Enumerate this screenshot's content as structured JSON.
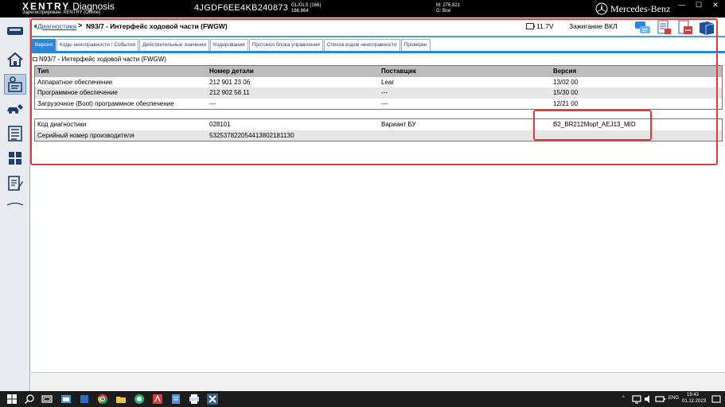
{
  "app": {
    "brand_name": "XENTRY",
    "brand_suffix": "Diagnosis",
    "registration": "Зарегистрирован: XENTRY (Offline)",
    "vin": "4JGDF6EE4KB240873",
    "gl_line1": "GL/GLS (166)",
    "gl_line2": "166.864",
    "stat_m": "M: 276.821",
    "stat_g": "G: Все",
    "maker": "Mercedes-Benz",
    "win_minimize": "—",
    "win_maximize": "☐",
    "win_close": "✕"
  },
  "header": {
    "breadcrumb_link": "Диагностика",
    "breadcrumb_sep": ">",
    "title": "N93/7 - Интерфейс ходовой части (FWGW)",
    "voltage": "11.7V",
    "ignition": "Зажигание ВКЛ"
  },
  "tabs": [
    {
      "label": "Версия"
    },
    {
      "label": "Коды неисправности / События"
    },
    {
      "label": "Действительные значения"
    },
    {
      "label": "Кодирования"
    },
    {
      "label": "Протокол блока управления"
    },
    {
      "label": "Список кодов неисправности"
    },
    {
      "label": "Проверки"
    }
  ],
  "main": {
    "section_title": "N93/7 - Интерфейс ходовой части (FWGW)",
    "columns": [
      "Тип",
      "Номер детали",
      "Поставщик",
      "Версия"
    ],
    "rows": [
      [
        "Аппаратное обеспечение",
        "212 901 23 06",
        "Lear",
        "13/02 00"
      ],
      [
        "Программное обеспечение",
        "212 902 58 11",
        "---",
        "15/30 00"
      ],
      [
        "Загрузочное (Boot) программное обеспечение",
        "---",
        "---",
        "12/21 00"
      ]
    ],
    "info_rows": [
      [
        "Код диагностики",
        "028101",
        "Вариант БУ",
        "B2_BR212Mopf_AEJ13_MID"
      ],
      [
        "Серийный номер производителя",
        "5325378220544138021811З0",
        "",
        ""
      ]
    ]
  },
  "taskbar": {
    "lang": "ENG",
    "time": "19:43",
    "date": "01.12.2023"
  },
  "colors": {
    "accent": "#2b88d8",
    "annotation": "#e03b3b",
    "header_row": "#bdbdbd"
  }
}
